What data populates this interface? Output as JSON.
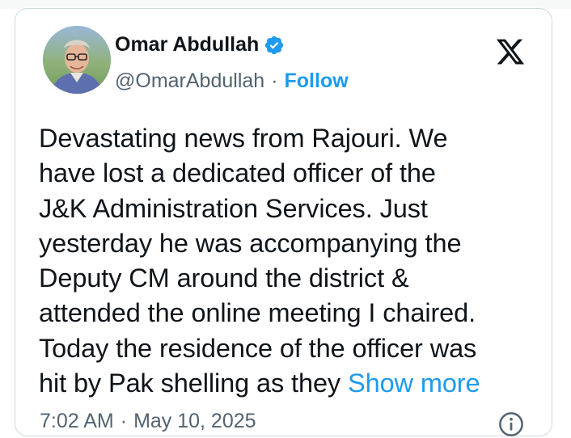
{
  "author": {
    "name": "Omar Abdullah",
    "handle": "@OmarAbdullah",
    "separator": "·",
    "follow_label": "Follow",
    "verified_icon": "verified-badge-icon",
    "avatar": "profile-photo"
  },
  "platform": {
    "logo_icon": "x-logo-icon"
  },
  "tweet": {
    "lines": [
      "Devastating news from Rajouri. We",
      "have lost a dedicated officer of the",
      "J&K Administration Services. Just",
      "yesterday he was accompanying the",
      "Deputy CM around the district &",
      "attended the online meeting I chaired.",
      "Today the residence of the officer was",
      "hit by Pak shelling as they"
    ],
    "show_more_label": "Show more"
  },
  "meta": {
    "time": "7:02 AM",
    "separator": "·",
    "date": "May 10, 2025",
    "info_icon": "info-icon"
  },
  "colors": {
    "accent": "#1d9bf0",
    "text": "#0f1419",
    "secondary": "#536471",
    "border": "#cfd9de"
  }
}
